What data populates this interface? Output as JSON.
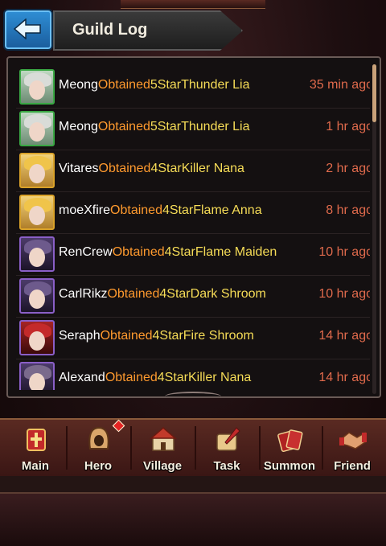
{
  "header": {
    "title": "Guild Log"
  },
  "log": [
    {
      "name": "Meong",
      "action": "Obtained",
      "item": "5StarThunder Lia",
      "time": "35 min ago",
      "avatar": "green"
    },
    {
      "name": "Meong",
      "action": "Obtained",
      "item": "5StarThunder Lia",
      "time": "1 hr ago",
      "avatar": "green"
    },
    {
      "name": "Vitares",
      "action": "Obtained",
      "item": "4StarKiller Nana",
      "time": "2 hr ago",
      "avatar": "gold"
    },
    {
      "name": "moeXfire",
      "action": "Obtained",
      "item": "4StarFlame Anna",
      "time": "8 hr ago",
      "avatar": "gold"
    },
    {
      "name": "RenCrew",
      "action": "Obtained",
      "item": "4StarFlame Maiden",
      "time": "10 hr ago",
      "avatar": "purple"
    },
    {
      "name": "CarlRikz",
      "action": "Obtained",
      "item": "4StarDark Shroom",
      "time": "10 hr ago",
      "avatar": "purple"
    },
    {
      "name": "Seraph",
      "action": "Obtained",
      "item": "4StarFire Shroom",
      "time": "14 hr ago",
      "avatar": "red"
    },
    {
      "name": "Alexand",
      "action": "Obtained",
      "item": "4StarKiller Nana",
      "time": "14 hr ago",
      "avatar": "purple"
    }
  ],
  "nav": [
    {
      "label": "Main",
      "icon": "castle-shield-icon"
    },
    {
      "label": "Hero",
      "icon": "hooded-hero-icon"
    },
    {
      "label": "Village",
      "icon": "village-castle-icon"
    },
    {
      "label": "Task",
      "icon": "quill-scroll-icon"
    },
    {
      "label": "Summon",
      "icon": "cards-icon"
    },
    {
      "label": "Friend",
      "icon": "handshake-icon"
    }
  ],
  "colors": {
    "name": "#ffffff",
    "action": "#ff9a2e",
    "item": "#f6dc57",
    "time": "#e06a4c"
  }
}
